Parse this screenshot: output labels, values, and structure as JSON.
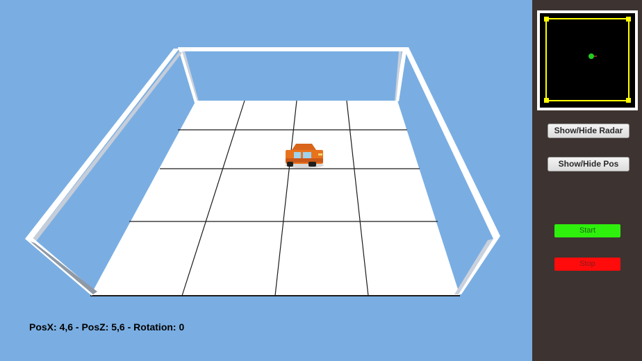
{
  "scene": {
    "sky_color": "#7aaee3",
    "floor_color": "#ffffff",
    "grid_line_color": "#1a1a1a",
    "wall_color": "#ffffff",
    "wall_shade_color": "#a9b4c4",
    "car": {
      "body_color": "#e8731d",
      "window_color": "#9fd3ee"
    }
  },
  "status": {
    "position_text": "PosX: 4,6 - PosZ: 5,6 - Rotation: 0"
  },
  "panel": {
    "background": "#3d3330",
    "radar": {
      "frame_color": "#ffffff",
      "screen_color": "#000000",
      "boundary_color": "#ffff00",
      "blip_color": "#22cc22"
    },
    "buttons": {
      "radar_label": "Show/Hide Radar",
      "pos_label": "Show/Hide Pos",
      "start_label": "Start",
      "stop_label": "Stop",
      "start_color": "#2ef00c",
      "stop_color": "#ff0b0b"
    }
  }
}
